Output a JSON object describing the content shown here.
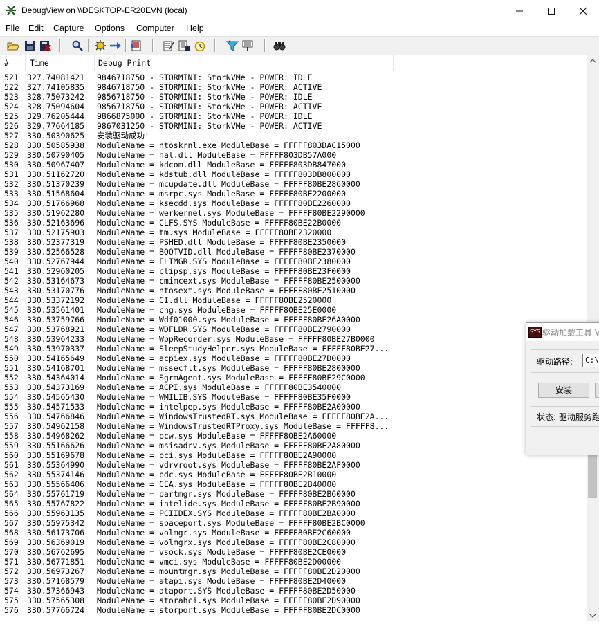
{
  "window": {
    "title": "DebugView on \\\\DESKTOP-ER20EVN (local)"
  },
  "menu": [
    "File",
    "Edit",
    "Capture",
    "Options",
    "Computer",
    "Help"
  ],
  "toolbar_icons": [
    "open-icon",
    "save-icon",
    "clear-icon",
    "find-icon",
    "capture-icon",
    "autoscroll-icon",
    "history-icon",
    "copy-icon",
    "log-icon",
    "clock-icon",
    "filter-icon",
    "highlight-icon",
    "search-icon"
  ],
  "columns": {
    "num": "#",
    "time": "Time",
    "print": "Debug Print"
  },
  "rows": [
    [
      "521",
      "327.74081421",
      "9846718750 - STORMINI: StorNVMe - POWER: IDLE"
    ],
    [
      "522",
      "327.74105835",
      "9846718750 - STORMINI: StorNVMe - POWER: ACTIVE"
    ],
    [
      "523",
      "328.75073242",
      "9856718750 - STORMINI: StorNVMe - POWER: IDLE"
    ],
    [
      "524",
      "328.75094604",
      "9856718750 - STORMINI: StorNVMe - POWER: ACTIVE"
    ],
    [
      "525",
      "329.76205444",
      "9866875000 - STORMINI: StorNVMe - POWER: IDLE"
    ],
    [
      "526",
      "329.77664185",
      "9867031250 - STORMINI: StorNVMe - POWER: ACTIVE"
    ],
    [
      "527",
      "330.50390625",
      "安装驱动成功!"
    ],
    [
      "528",
      "330.50585938",
      "ModuleName = ntoskrnl.exe ModuleBase = FFFFF803DAC15000"
    ],
    [
      "529",
      "330.50790405",
      "ModuleName = hal.dll ModuleBase = FFFFF803DB57A000"
    ],
    [
      "530",
      "330.50967407",
      "ModuleName = kdcom.dll ModuleBase = FFFFF803DB847000"
    ],
    [
      "531",
      "330.51162720",
      "ModuleName = kdstub.dll ModuleBase = FFFFF803DB800000"
    ],
    [
      "532",
      "330.51370239",
      "ModuleName = mcupdate.dll ModuleBase = FFFFF80BE2860000"
    ],
    [
      "533",
      "330.51568604",
      "ModuleName = msrpc.sys ModuleBase = FFFFF80BE2200000"
    ],
    [
      "534",
      "330.51766968",
      "ModuleName = ksecdd.sys ModuleBase = FFFFF80BE2260000"
    ],
    [
      "535",
      "330.51962280",
      "ModuleName = werkernel.sys ModuleBase = FFFFF80BE2290000"
    ],
    [
      "536",
      "330.52163696",
      "ModuleName = CLFS.SYS ModuleBase = FFFFF80BE22B0000"
    ],
    [
      "537",
      "330.52175903",
      "ModuleName = tm.sys ModuleBase = FFFFF80BE2320000"
    ],
    [
      "538",
      "330.52377319",
      "ModuleName = PSHED.dll ModuleBase = FFFFF80BE2350000"
    ],
    [
      "539",
      "330.52566528",
      "ModuleName = BOOTVID.dll ModuleBase = FFFFF80BE2370000"
    ],
    [
      "540",
      "330.52767944",
      "ModuleName = FLTMGR.SYS ModuleBase = FFFFF80BE2380000"
    ],
    [
      "541",
      "330.52960205",
      "ModuleName = clipsp.sys ModuleBase = FFFFF80BE23F0000"
    ],
    [
      "542",
      "330.53164673",
      "ModuleName = cmimcext.sys ModuleBase = FFFFF80BE2500000"
    ],
    [
      "543",
      "330.53170776",
      "ModuleName = ntosext.sys ModuleBase = FFFFF80BE2510000"
    ],
    [
      "544",
      "330.53372192",
      "ModuleName = CI.dll ModuleBase = FFFFF80BE2520000"
    ],
    [
      "545",
      "330.53561401",
      "ModuleName = cng.sys ModuleBase = FFFFF80BE25E0000"
    ],
    [
      "546",
      "330.53759766",
      "ModuleName = Wdf01000.sys ModuleBase = FFFFF80BE26A0000"
    ],
    [
      "547",
      "330.53768921",
      "ModuleName = WDFLDR.SYS ModuleBase = FFFFF80BE2790000"
    ],
    [
      "548",
      "330.53964233",
      "ModuleName = WppRecorder.sys ModuleBase = FFFFF80BE27B0000"
    ],
    [
      "549",
      "330.53970337",
      "ModuleName = SleepStudyHelper.sys ModuleBase = FFFFF80BE27..."
    ],
    [
      "550",
      "330.54165649",
      "ModuleName = acpiex.sys ModuleBase = FFFFF80BE27D0000"
    ],
    [
      "551",
      "330.54168701",
      "ModuleName = mssecflt.sys ModuleBase = FFFFF80BE2800000"
    ],
    [
      "552",
      "330.54364014",
      "ModuleName = SgrmAgent.sys ModuleBase = FFFFF80BE29C0000"
    ],
    [
      "553",
      "330.54373169",
      "ModuleName = ACPI.sys ModuleBase = FFFFF80BE3540000"
    ],
    [
      "554",
      "330.54565430",
      "ModuleName = WMILIB.SYS ModuleBase = FFFFF80BE35F0000"
    ],
    [
      "555",
      "330.54571533",
      "ModuleName = intelpep.sys ModuleBase = FFFFF80BE2A00000"
    ],
    [
      "556",
      "330.54766846",
      "ModuleName = WindowsTrustedRT.sys ModuleBase = FFFFF80BE2A..."
    ],
    [
      "557",
      "330.54962158",
      "ModuleName = WindowsTrustedRTProxy.sys ModuleBase = FFFFF8..."
    ],
    [
      "558",
      "330.54968262",
      "ModuleName = pcw.sys ModuleBase = FFFFF80BE2A60000"
    ],
    [
      "559",
      "330.55166626",
      "ModuleName = msisadrv.sys ModuleBase = FFFFF80BE2A80000"
    ],
    [
      "560",
      "330.55169678",
      "ModuleName = pci.sys ModuleBase = FFFFF80BE2A90000"
    ],
    [
      "561",
      "330.55364990",
      "ModuleName = vdrvroot.sys ModuleBase = FFFFF80BE2AF0000"
    ],
    [
      "562",
      "330.55374146",
      "ModuleName = pdc.sys ModuleBase = FFFFF80BE2B10000"
    ],
    [
      "563",
      "330.55566406",
      "ModuleName = CEA.sys ModuleBase = FFFFF80BE2B40000"
    ],
    [
      "564",
      "330.55761719",
      "ModuleName = partmgr.sys ModuleBase = FFFFF80BE2B60000"
    ],
    [
      "565",
      "330.55767822",
      "ModuleName = intelide.sys ModuleBase = FFFFF80BE2B90000"
    ],
    [
      "566",
      "330.55963135",
      "ModuleName = PCIIDEX.SYS ModuleBase = FFFFF80BE2BA0000"
    ],
    [
      "567",
      "330.55975342",
      "ModuleName = spaceport.sys ModuleBase = FFFFF80BE2BC0000"
    ],
    [
      "568",
      "330.56173706",
      "ModuleName = volmgr.sys ModuleBase = FFFFF80BE2C60000"
    ],
    [
      "569",
      "330.56369019",
      "ModuleName = volmgrx.sys ModuleBase = FFFFF80BE2C80000"
    ],
    [
      "570",
      "330.56762695",
      "ModuleName = vsock.sys ModuleBase = FFFFF80BE2CE0000"
    ],
    [
      "571",
      "330.56771851",
      "ModuleName = vmci.sys ModuleBase = FFFFF80BE2D00000"
    ],
    [
      "572",
      "330.56973267",
      "ModuleName = mountmgr.sys ModuleBase = FFFFF80BE2D20000"
    ],
    [
      "573",
      "330.57168579",
      "ModuleName = atapi.sys ModuleBase = FFFFF80BE2D40000"
    ],
    [
      "574",
      "330.57366943",
      "ModuleName = ataport.SYS ModuleBase = FFFFF80BE2D50000"
    ],
    [
      "575",
      "330.57565308",
      "ModuleName = storahci.sys ModuleBase = FFFFF80BE2D90000"
    ],
    [
      "576",
      "330.57766724",
      "ModuleName = storport.sys ModuleBase = FFFFF80BE2DC0000"
    ]
  ],
  "dialog": {
    "icon_text": "SYS",
    "title": "驱动加载工具 V",
    "path_label": "驱动路径:",
    "path_value": "C:\\U",
    "install_button": "安装",
    "status_text": "状态: 驱动服务跑"
  }
}
